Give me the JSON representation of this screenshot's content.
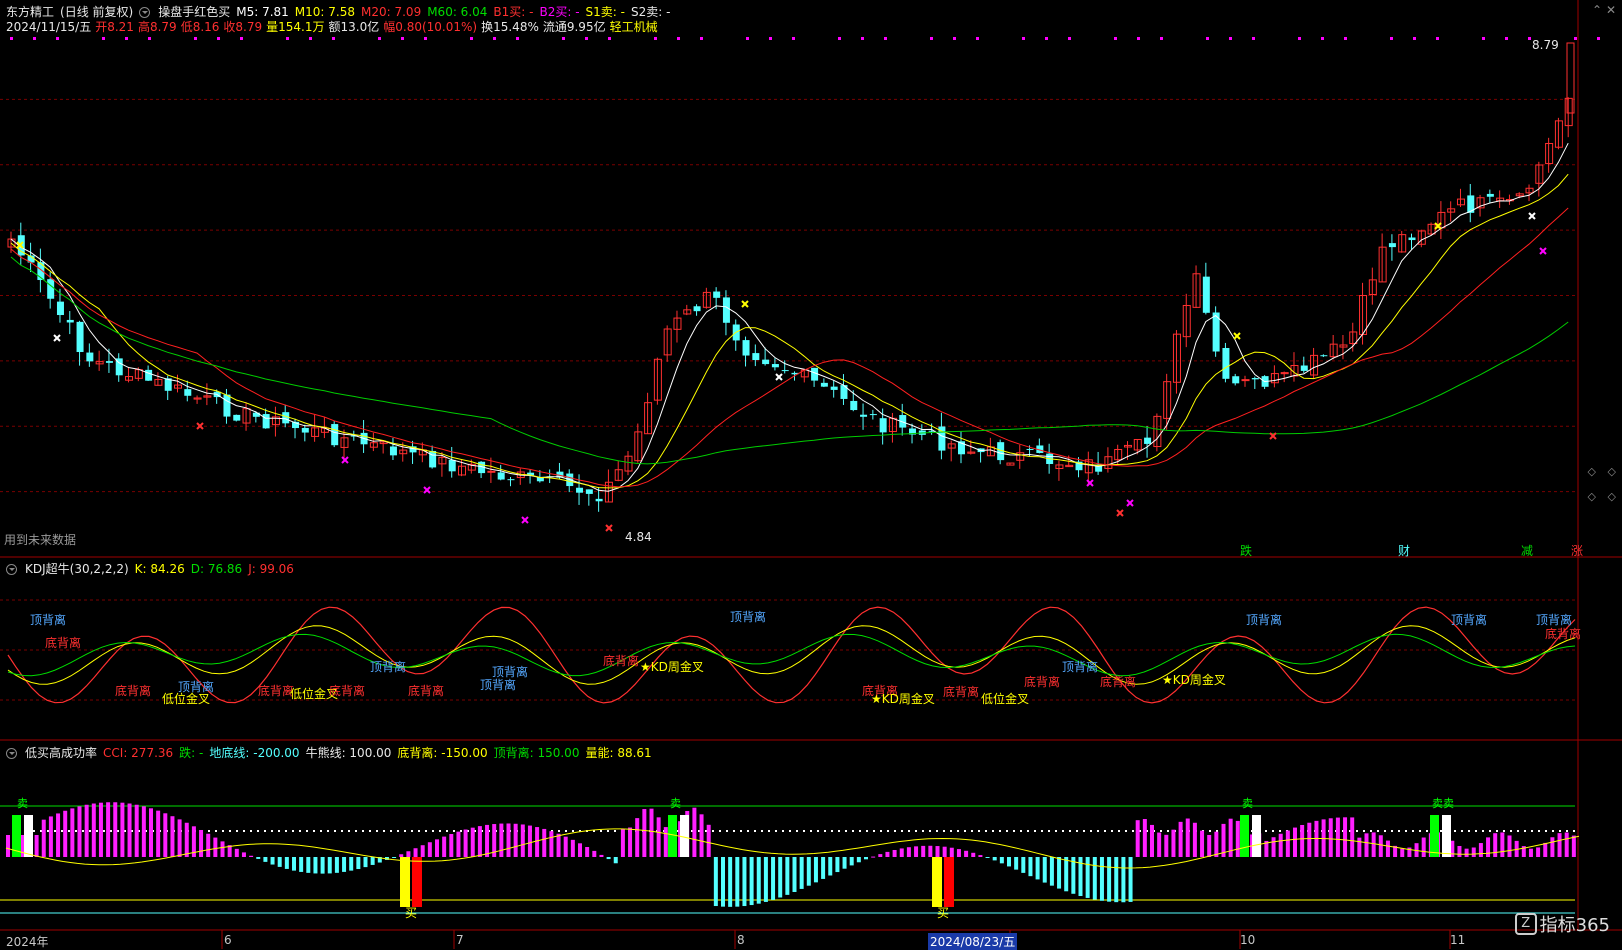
{
  "header": {
    "stock_name": "东方精工",
    "period": "(日线 前复权)",
    "indicator_name": "操盘手红色买",
    "ma5": "M5: 7.81",
    "ma10": "M10: 7.58",
    "ma20": "M20: 7.09",
    "ma60": "M60: 6.04",
    "b1": "B1买: -",
    "b2": "B2买: -",
    "s1": "S1卖: -",
    "s2": "S2卖: -",
    "date": "2024/11/15/五",
    "open": "开8.21",
    "high": "高8.79",
    "low": "低8.16",
    "close": "收8.79",
    "volume": "量154.1万",
    "amount": "额13.0亿",
    "change": "幅0.80(10.01%)",
    "turnover": "换15.48%",
    "float_cap": "流通9.95亿",
    "industry": "轻工机械"
  },
  "main_chart": {
    "price_high_label": "8.79",
    "price_low_label": "4.84",
    "future_data_note": "用到未来数据",
    "bottom_tags": [
      "跌",
      "财",
      "减",
      "涨"
    ]
  },
  "kdj_panel": {
    "name": "KDJ超牛(30,2,2,2)",
    "k": "K: 84.26",
    "d": "D: 76.86",
    "j": "J: 99.06",
    "annotations": [
      "顶背离",
      "底背离",
      "底背离",
      "顶背离",
      "低位金叉",
      "底背离",
      "低位金叉",
      "顶背离",
      "底背离",
      "底背离",
      "顶背离",
      "顶背离",
      "底背离",
      "KD周金叉",
      "顶背离",
      "底背离",
      "底背离",
      "KD周金叉",
      "低位金叉",
      "底背离",
      "顶背离",
      "底背离",
      "KD周金叉",
      "顶背离",
      "顶背离",
      "顶背离",
      "底背离"
    ]
  },
  "cci_panel": {
    "name": "低买高成功率",
    "cci": "CCI: 277.36",
    "die": "跌: -",
    "floor_line": "地底线: -200.00",
    "bull_line": "牛熊线: 100.00",
    "bottom_div": "底背离: -150.00",
    "top_div": "顶背离: 150.00",
    "volume_energy": "量能: 88.61",
    "buy_labels": [
      "买",
      "买"
    ],
    "sell_labels": [
      "卖",
      "卖",
      "卖",
      "卖",
      "卖"
    ]
  },
  "x_axis": {
    "labels": [
      "2024年",
      "6",
      "7",
      "8",
      "2024/08/23/五",
      "10",
      "11"
    ]
  },
  "watermark": "指标365",
  "colors": {
    "ma5": "#ffffff",
    "ma10": "#ffff00",
    "ma20": "#ff2020",
    "ma60": "#00cc00",
    "up_candle": "#ff3030",
    "down_candle": "#54ffff",
    "grid": "#7a0000",
    "magenta": "#ff00ff"
  }
}
